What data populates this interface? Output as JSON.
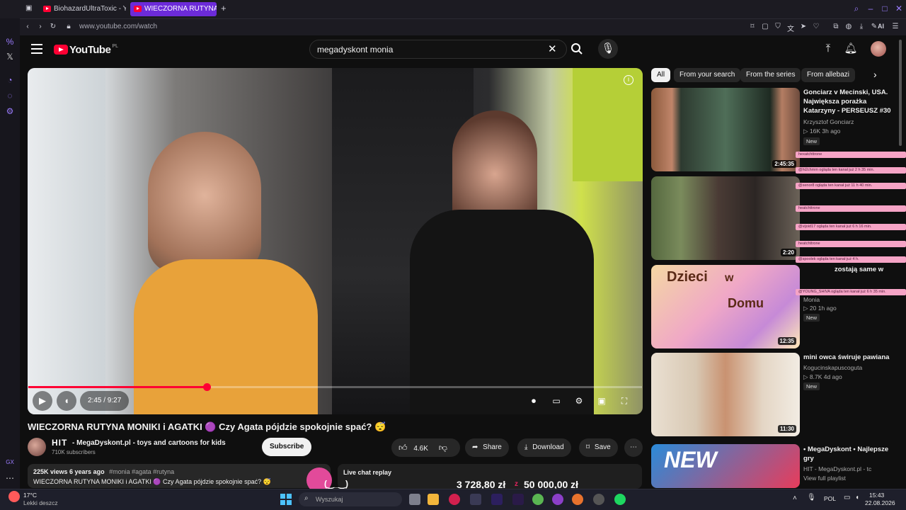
{
  "browser": {
    "tabs": [
      {
        "label": "BiohazardUltraToxic - YouTu"
      },
      {
        "label": "WIECZORNA RUTYNA MON"
      }
    ],
    "url": "www.youtube.com/watch",
    "ai_label": "AI"
  },
  "youtube": {
    "logo_text": "YouTube",
    "country": "PL",
    "search_value": "megadyskont monia"
  },
  "player": {
    "time": "2:45 / 9:27",
    "progress": 0.2909,
    "overlay_price_a": "3 728,80 zł",
    "overlay_price_b": "50 000,00 zł",
    "overlay_face": "(‿_‿)"
  },
  "video": {
    "title": "WIECZORNA RUTYNA MONIKI i AGATKI 🟣 Czy Agata pójdzie spokojnie spać? 😴",
    "channel_logo": "HIT",
    "channel": "- MegaDyskont.pl - toys and cartoons for kids",
    "subscribers": "710K subscribers",
    "subscribe_label": "Subscribe",
    "likes": "4.6K",
    "share_label": "Share",
    "download_label": "Download",
    "save_label": "Save",
    "views_line": "225K views  6 years ago",
    "hashtags": "#monia #agata #rutyna",
    "desc_line": "WIECZORNA RUTYNA MONIKI i AGATKI 🟣 Czy Agata pójdzie spokojnie spać? 😴",
    "live_chat_label": "Live chat replay"
  },
  "chips": [
    "All",
    "From your search",
    "From the series",
    "From allebazi"
  ],
  "recommendations": [
    {
      "title": "Gonciarz v Mecinski, USA. Największa porażka Katarzyny - PERSEUSZ #30",
      "channel": "Krzysztof Gonciarz",
      "meta": "▷ 16K  3h ago",
      "badge": "New",
      "duration": "2:45:35"
    },
    {
      "title": "",
      "channel": "",
      "meta": "",
      "badge": "",
      "duration": "2:20"
    },
    {
      "title": "zostają same w",
      "channel": "Monia",
      "meta": "▷ 20  1h ago",
      "badge": "New",
      "duration": "12:35",
      "thumb_text_a": "Dzieci",
      "thumb_text_b": "w",
      "thumb_text_c": "Domu"
    },
    {
      "title": "mini owca świruje pawiana",
      "channel": "Kogucinskapuscoguta",
      "meta": "▷ 8.7K  4d ago",
      "badge": "New",
      "duration": "11:30"
    },
    {
      "title": "• MegaDyskont • Najlepsze gry",
      "channel": "HIT - MegaDyskont.pl - tc",
      "meta": "View full playlist",
      "badge": "",
      "duration": "",
      "thumb_text_a": "NEW"
    }
  ],
  "chat_overlay": [
    "hexatchttrone",
    "@hi2chmm ogląda ten kanał już 2 h 35 min.",
    "@xenor8 ogląda ten kanał już 11 h 40 min.",
    "heatchttrone",
    "@vijoid17 ogląda ten kanał już 6 h 16 min.",
    "heatchttrone",
    "@spoolek ogląda ten kanał już 4 h.",
    "@YOUNG_SHIVA ogląda ten kanał już 6 h 35 min."
  ],
  "taskbar": {
    "weather_temp": "17°C",
    "weather_desc": "Lekki deszcz",
    "search_placeholder": "Wyszukaj",
    "lang": "POL",
    "time": "15:43",
    "date": "22.08.2026"
  }
}
